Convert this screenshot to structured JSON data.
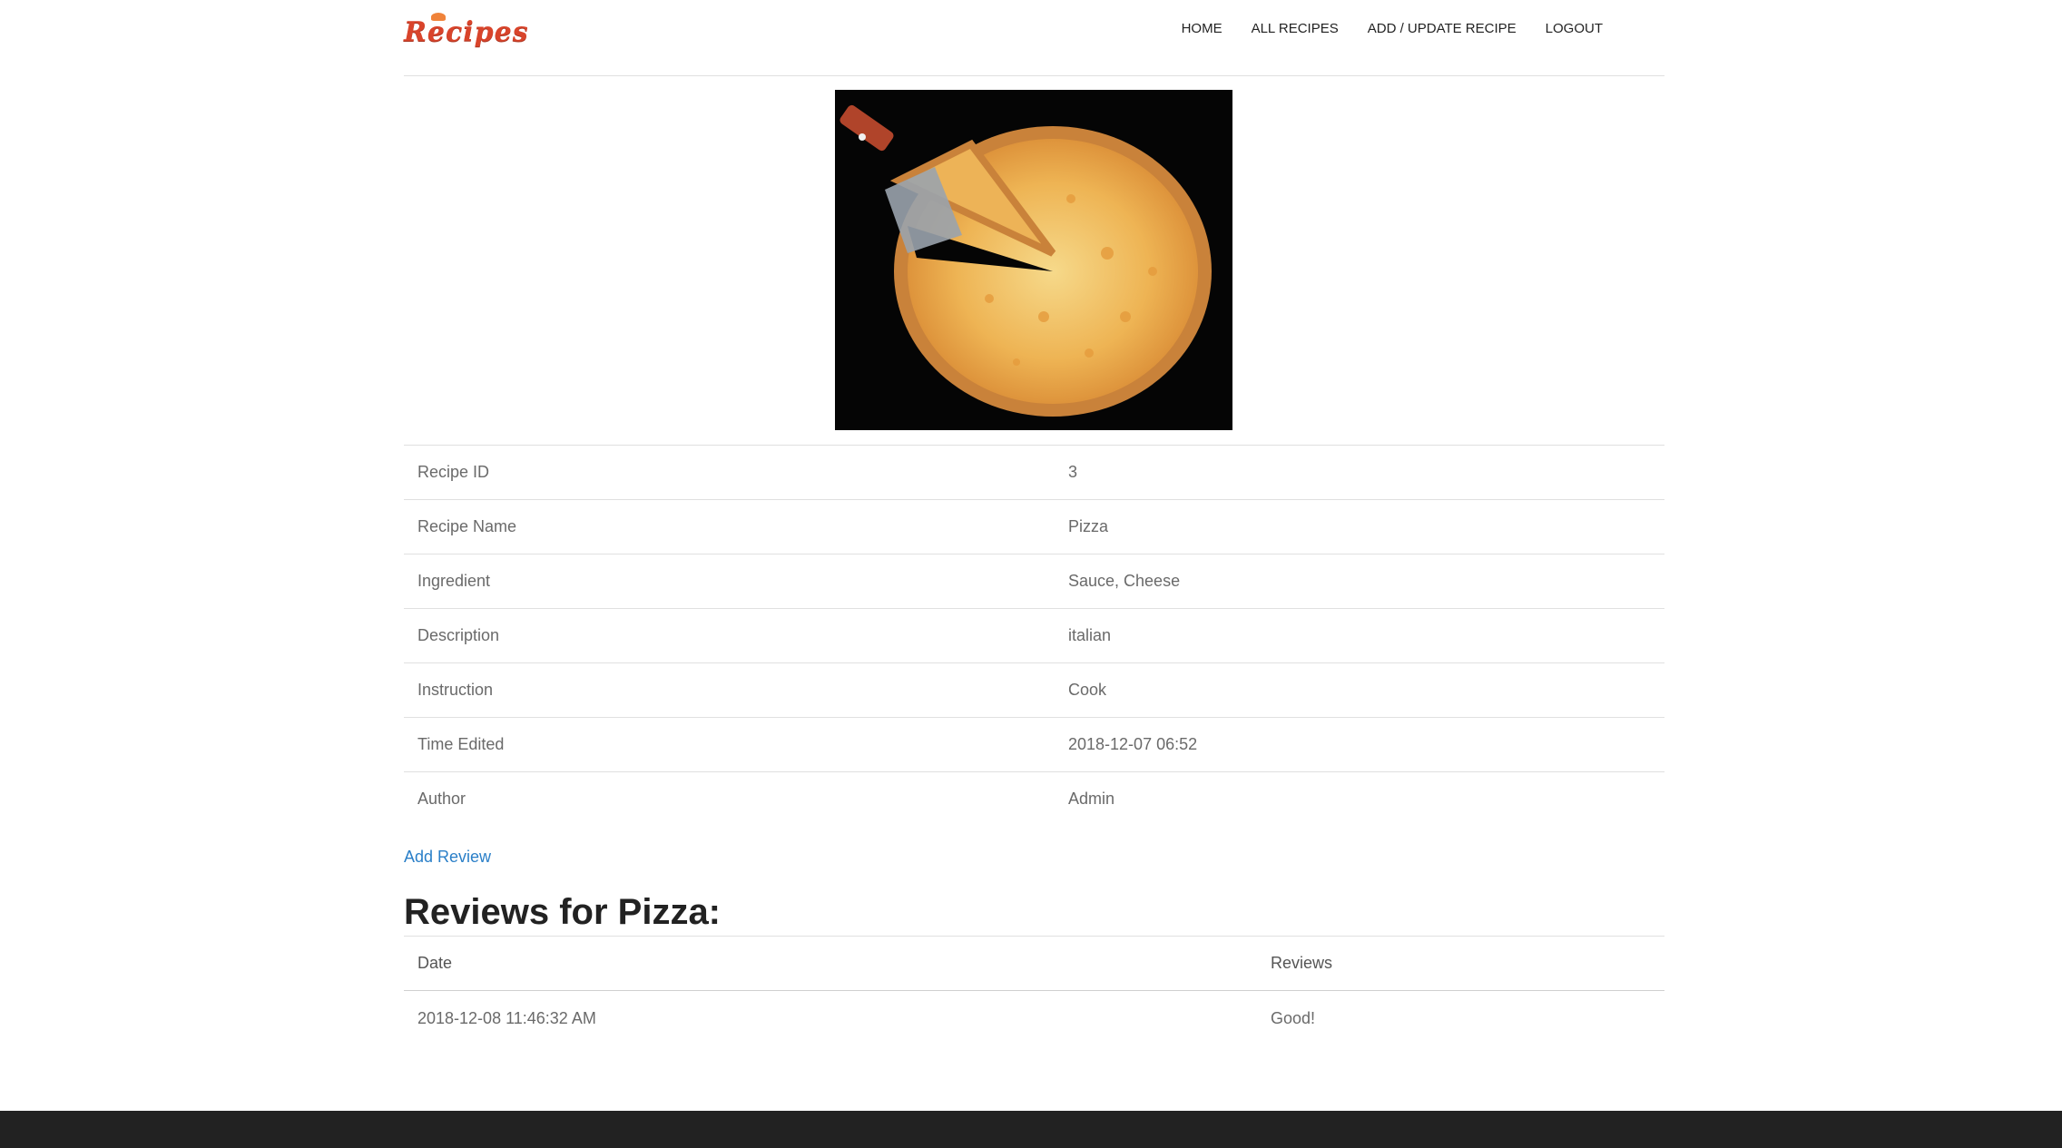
{
  "header": {
    "logo_text": "Recipes",
    "nav": [
      "HOME",
      "ALL RECIPES",
      "ADD / UPDATE RECIPE",
      "LOGOUT"
    ]
  },
  "recipe": {
    "image_alt": "pizza-image",
    "rows": [
      {
        "label": "Recipe ID",
        "value": "3"
      },
      {
        "label": "Recipe Name",
        "value": "Pizza"
      },
      {
        "label": "Ingredient",
        "value": "Sauce, Cheese"
      },
      {
        "label": "Description",
        "value": "italian"
      },
      {
        "label": "Instruction",
        "value": "Cook"
      },
      {
        "label": "Time Edited",
        "value": "2018-12-07 06:52"
      },
      {
        "label": "Author",
        "value": "Admin"
      }
    ]
  },
  "add_review_label": "Add Review",
  "reviews": {
    "title": "Reviews for Pizza:",
    "headers": [
      "Date",
      "Reviews"
    ],
    "rows": [
      {
        "date": "2018-12-08 11:46:32 AM",
        "review": "Good!"
      }
    ]
  },
  "colors": {
    "accent": "#d9442b",
    "link": "#2a7fc8",
    "footer": "#222222"
  }
}
